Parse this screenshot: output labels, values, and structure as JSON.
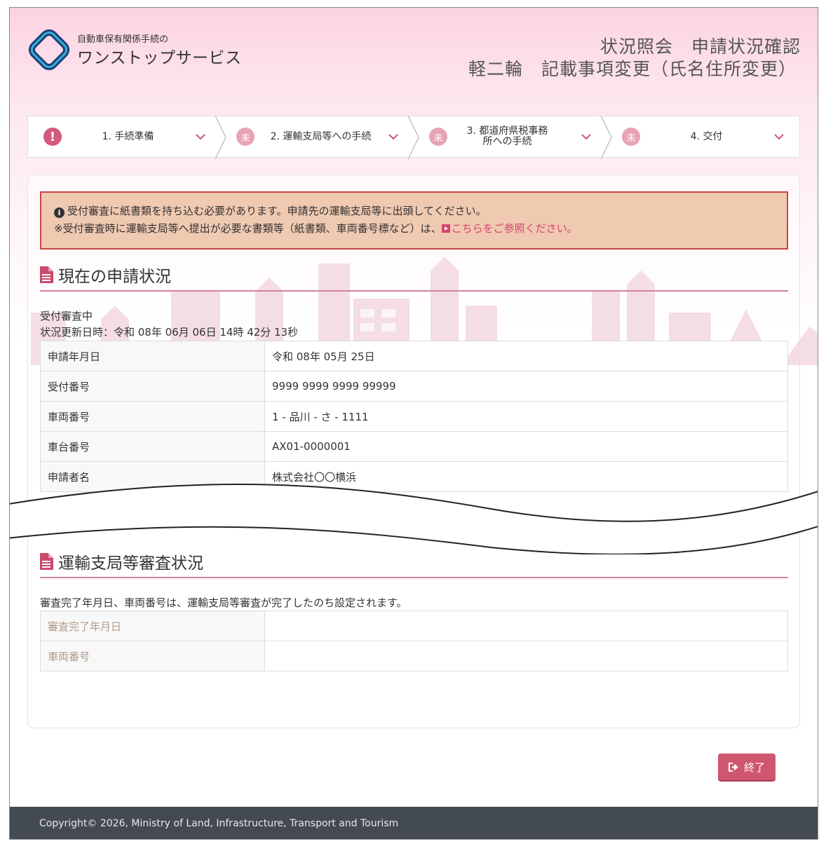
{
  "header": {
    "logo_sub": "自動車保有関係手続の",
    "logo_main": "ワンストップサービス",
    "title_line1": "状況照会　申請状況確認",
    "title_line2": "軽二輪　記載事項変更（氏名住所変更）"
  },
  "steps": [
    {
      "badge": "!",
      "label": "1. 手続準備",
      "icon": "alert-icon"
    },
    {
      "badge": "未",
      "label": "2. 運輸支局等への手続",
      "icon": "pending-icon"
    },
    {
      "badge": "未",
      "label": "3. 都道府県税事務所への手続",
      "icon": "pending-icon"
    },
    {
      "badge": "未",
      "label": "4. 交付",
      "icon": "pending-icon"
    }
  ],
  "alert": {
    "line1": "受付審査に紙書類を持ち込む必要があります。申請先の運輸支局等に出頭してください。",
    "line2": "※受付審査時に運輸支局等へ提出が必要な書類等（紙書類、車両番号標など）は、",
    "link_text": "こちらをご参照ください。"
  },
  "current_status": {
    "title": "現在の申請状況",
    "status": "受付審査中",
    "updated": "状況更新日時：令和 08年 06月 06日 14時 42分 13秒",
    "rows": [
      {
        "label": "申請年月日",
        "value": "令和 08年 05月 25日"
      },
      {
        "label": "受付番号",
        "value": "9999 9999 9999 99999"
      },
      {
        "label": "車両番号",
        "value": "1 - 品川 - さ - 1111"
      },
      {
        "label": "車台番号",
        "value": "AX01-0000001"
      },
      {
        "label": "申請者名",
        "value": "株式会社〇〇横浜"
      }
    ]
  },
  "review_status": {
    "title": "運輸支局等審査状況",
    "note": "審査完了年月日、車両番号は、運輸支局等審査が完了したのち設定されます。",
    "rows": [
      {
        "label": "審査完了年月日",
        "value": ""
      },
      {
        "label": "車両番号",
        "value": ""
      }
    ]
  },
  "end_button": "終了",
  "footer": "Copyright© 2026, Ministry of Land, Infrastructure, Transport and Tourism",
  "colors": {
    "accent": "#d0566f",
    "alert_bg": "#f0c9b1",
    "alert_border": "#c94545",
    "footer_bg": "#444a52"
  }
}
